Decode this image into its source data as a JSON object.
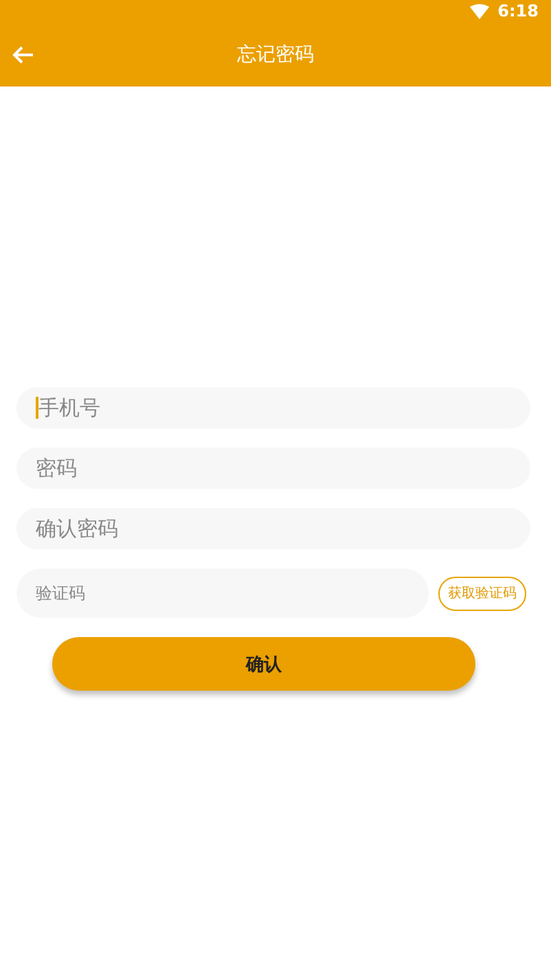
{
  "status_bar": {
    "time": "6:18"
  },
  "app_bar": {
    "title": "忘记密码"
  },
  "fields": [
    {
      "placeholder": "手机号",
      "focused": true
    },
    {
      "placeholder": "密码",
      "focused": false
    },
    {
      "placeholder": "确认密码",
      "focused": false
    }
  ],
  "code_field": {
    "placeholder": "验证码"
  },
  "code_button": {
    "label": "获取验证码"
  },
  "submit_button": {
    "label": "确认"
  }
}
